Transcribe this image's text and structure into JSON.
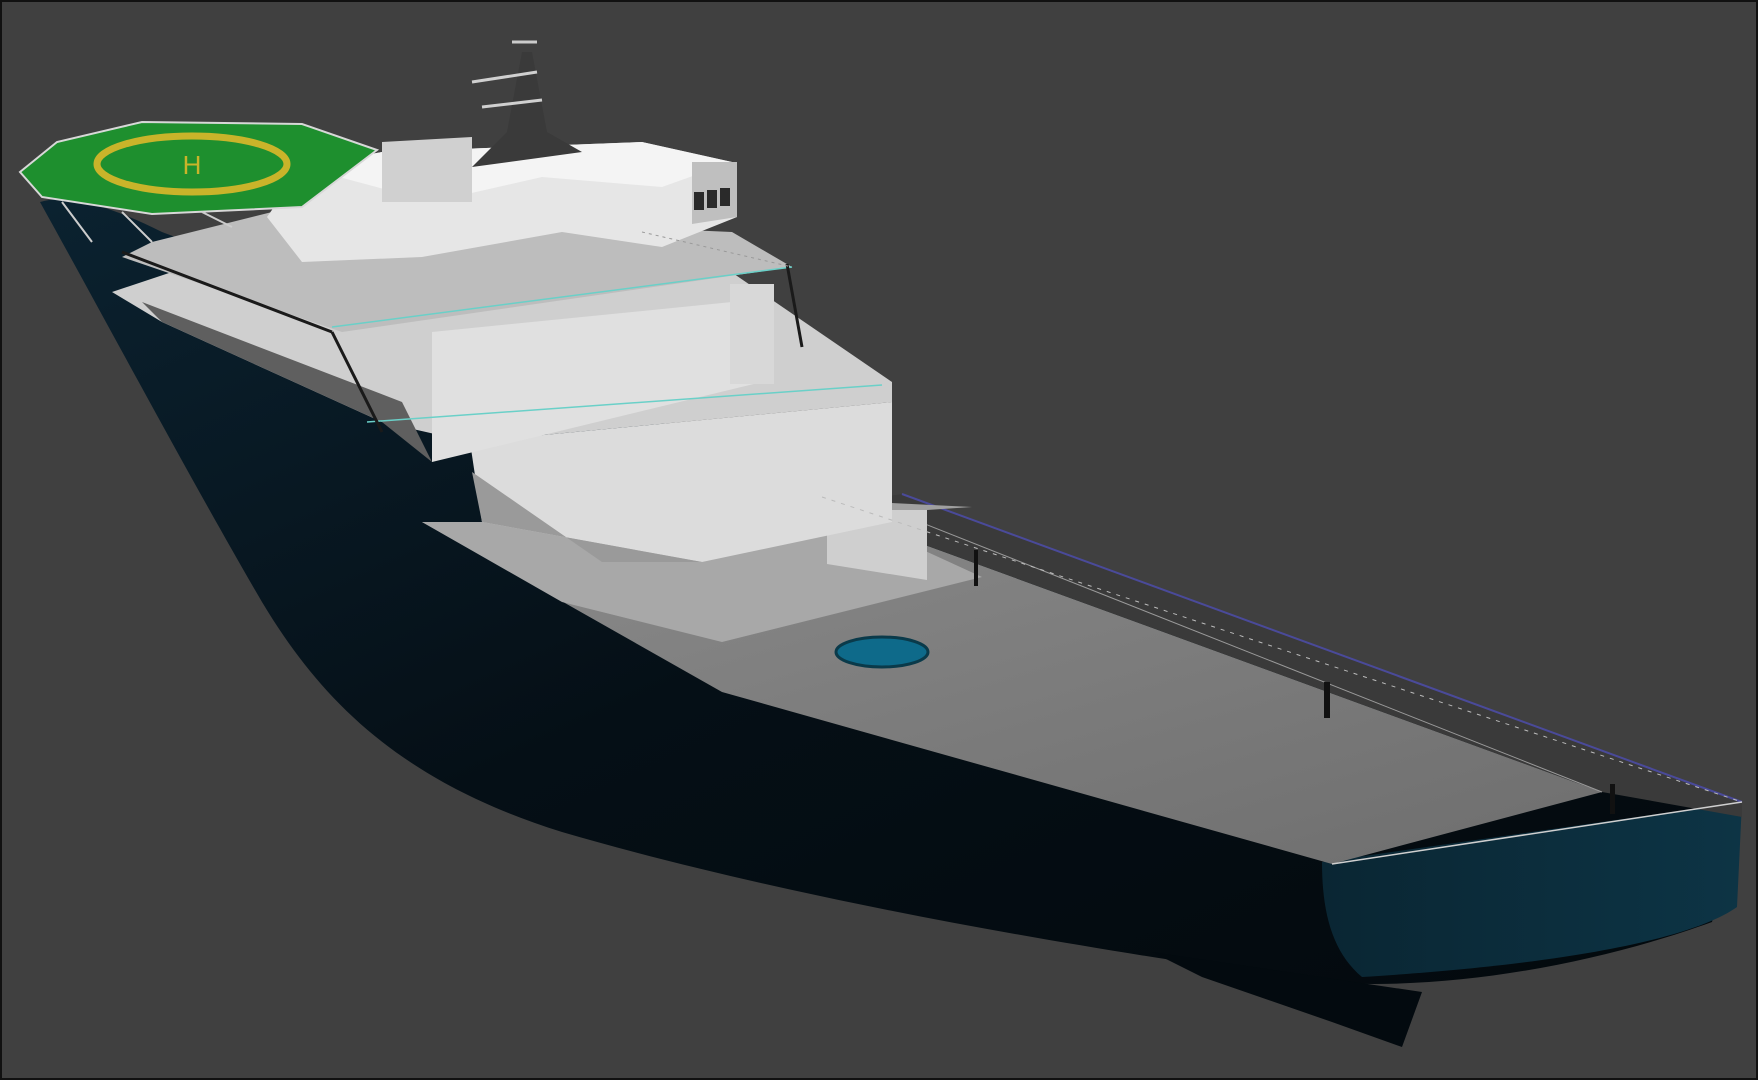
{
  "scene": {
    "subject": "offshore-supply-vessel-3d-model",
    "background_color": "#404040",
    "hull_color": "#06141c",
    "deck_color": "#7a7a7a",
    "superstructure_color": "#d6d6d6",
    "helideck_color": "#1e8f2e",
    "helideck_ring_color": "#c9b42a",
    "moonpool_color": "#0e6a8a"
  },
  "helideck": {
    "marking": "H"
  }
}
